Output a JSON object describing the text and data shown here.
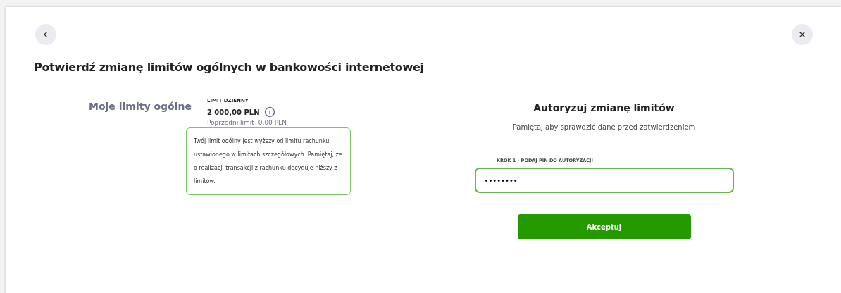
{
  "title": "Potwierdź zmianę limitów ogólnych w bankowości internetowej",
  "limits": {
    "heading": "Moje limity ogólne",
    "label": "LIMIT DZIENNY",
    "amount": "2 000,00 PLN",
    "previous_label": "Poprzedni limit",
    "previous_value": "0,00 PLN",
    "tooltip": "Twój limit ogólny jest wyższy od limitu rachunku ustawionego w limitach szczegółowych. Pamiętaj, że o realizacji transakcji z rachunku decyduje niższy z limitów."
  },
  "authorize": {
    "heading": "Autoryzuj zmianę limitów",
    "hint": "Pamiętaj aby sprawdzić dane przed zatwierdzeniem",
    "field_label": "KROK 1 - PODAJ PIN DO AUTORYZACJI",
    "field_value": "••••••••",
    "button": "Akceptuj"
  }
}
